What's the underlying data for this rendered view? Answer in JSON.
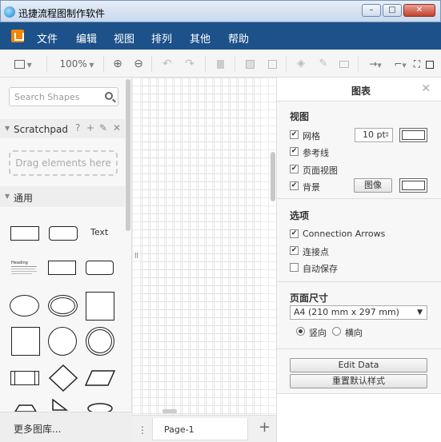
{
  "window": {
    "title": "迅捷流程图制作软件",
    "buttons": {
      "minimize": "–",
      "maximize": "□",
      "close": "✕"
    }
  },
  "menubar": {
    "items": [
      "文件",
      "编辑",
      "视图",
      "排列",
      "其他",
      "帮助"
    ]
  },
  "toolbar": {
    "zoom": "100%",
    "icons": [
      "page-view-icon",
      "zoom-in-icon",
      "zoom-out-icon",
      "undo-icon",
      "redo-icon",
      "delete-icon",
      "to-front-icon",
      "to-back-icon",
      "fill-color-icon",
      "line-color-icon",
      "shadow-icon",
      "connection-icon",
      "waypoints-icon",
      "format-panel-icon"
    ]
  },
  "sidebar": {
    "search_placeholder": "Search Shapes",
    "scratchpad": {
      "label": "Scratchpad",
      "help": "?",
      "add": "+",
      "edit": "✎",
      "close": "✕"
    },
    "dropzone": "Drag elements here",
    "general": {
      "label": "通用"
    },
    "shape_text": "Text",
    "heading_text": "Heading",
    "more_libraries": "更多图库..."
  },
  "pages": {
    "active": "Page-1",
    "add": "+"
  },
  "format_panel": {
    "tab": "图表",
    "close": "✕",
    "view": {
      "heading": "视图",
      "grid": {
        "label": "网格",
        "checked": true,
        "size": "10 pt"
      },
      "guides": {
        "label": "参考线",
        "checked": true
      },
      "page_view": {
        "label": "页面视图",
        "checked": true
      },
      "background": {
        "label": "背景",
        "checked": true,
        "image_button": "图像"
      }
    },
    "options": {
      "heading": "选项",
      "connection_arrows": {
        "label": "Connection Arrows",
        "checked": true
      },
      "connection_points": {
        "label": "连接点",
        "checked": true
      },
      "autosave": {
        "label": "自动保存",
        "checked": false
      }
    },
    "paper": {
      "heading": "页面尺寸",
      "size": "A4 (210 mm x 297 mm)",
      "portrait": "竖向",
      "landscape": "横向",
      "orientation": "portrait"
    },
    "edit_data_button": "Edit Data",
    "reset_style_button": "重置默认样式"
  }
}
